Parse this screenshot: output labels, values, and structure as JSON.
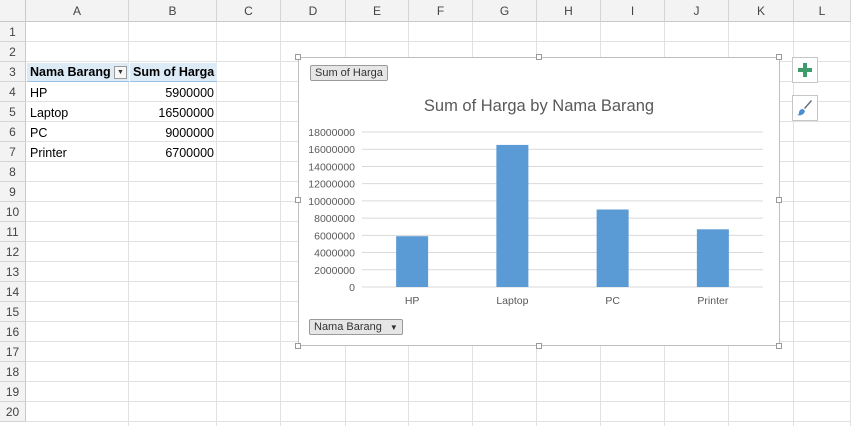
{
  "columns": [
    "A",
    "B",
    "C",
    "D",
    "E",
    "F",
    "G",
    "H",
    "I",
    "J",
    "K",
    "L"
  ],
  "rows": [
    "1",
    "2",
    "3",
    "4",
    "5",
    "6",
    "7",
    "8",
    "9",
    "10",
    "11",
    "12",
    "13",
    "14",
    "15",
    "16",
    "17",
    "18",
    "19",
    "20"
  ],
  "pivot": {
    "header_field": "Nama Barang",
    "header_value": "Sum of Harga",
    "rows": [
      {
        "label": "HP",
        "value": "5900000"
      },
      {
        "label": "Laptop",
        "value": "16500000"
      },
      {
        "label": "PC",
        "value": "9000000"
      },
      {
        "label": "Printer",
        "value": "6700000"
      }
    ]
  },
  "chart": {
    "value_field_button": "Sum of Harga",
    "axis_field_button": "Nama Barang",
    "bar_color": "#5b9bd5"
  },
  "chart_data": {
    "type": "bar",
    "title": "Sum of Harga by Nama Barang",
    "categories": [
      "HP",
      "Laptop",
      "PC",
      "Printer"
    ],
    "values": [
      5900000,
      16500000,
      9000000,
      6700000
    ],
    "ylim": [
      0,
      18000000
    ],
    "yticks": [
      "0",
      "2000000",
      "4000000",
      "6000000",
      "8000000",
      "10000000",
      "12000000",
      "14000000",
      "16000000",
      "18000000"
    ],
    "grid": true,
    "legend": "none"
  },
  "side_buttons": {
    "add": "plus-icon",
    "style": "brush-icon"
  }
}
